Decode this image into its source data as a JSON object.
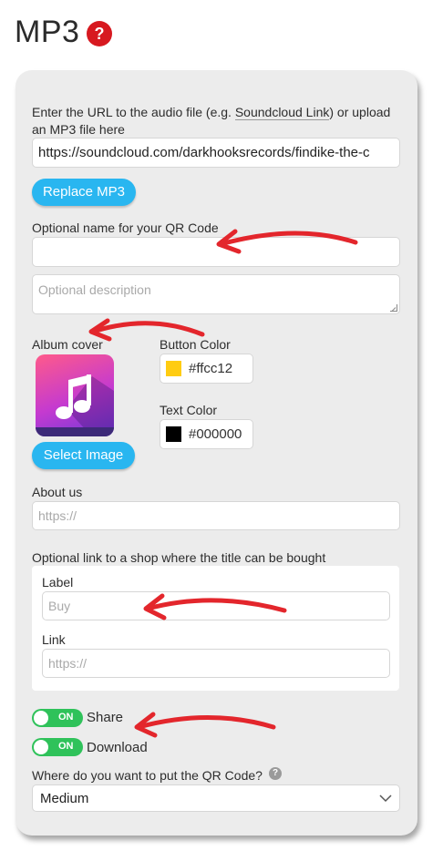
{
  "page": {
    "title": "MP3",
    "help_icon": "?"
  },
  "audio": {
    "label_part1": "Enter the URL to the audio file (e.g. ",
    "label_link": "Soundcloud Link",
    "label_part2": ") or upload an MP3 file here",
    "url_value": "https://soundcloud.com/darkhooksrecords/findike-the-c",
    "replace_button": "Replace MP3"
  },
  "name": {
    "label": "Optional name for your QR Code",
    "value": ""
  },
  "description": {
    "placeholder": "Optional description"
  },
  "album": {
    "label": "Album cover",
    "select_button": "Select Image",
    "icon": "music-note-icon"
  },
  "button_color": {
    "label": "Button Color",
    "value": "#ffcc12",
    "swatch": "#ffcc12"
  },
  "text_color": {
    "label": "Text Color",
    "value": "#000000",
    "swatch": "#000000"
  },
  "about": {
    "label": "About us",
    "placeholder": "https://"
  },
  "shop": {
    "label": "Optional link to a shop where the title can be bought",
    "label_field_label": "Label",
    "label_field_placeholder": "Buy",
    "link_field_label": "Link",
    "link_field_placeholder": "https://"
  },
  "toggles": {
    "share": {
      "state": "ON",
      "label": "Share"
    },
    "download": {
      "state": "ON",
      "label": "Download"
    }
  },
  "placement": {
    "label": "Where do you want to put the QR Code?",
    "help_icon": "?",
    "selected": "Medium"
  },
  "colors": {
    "accent_blue": "#29b6f0",
    "toggle_green": "#2fc25a",
    "help_red": "#d71920",
    "arrow_red": "#e3262c"
  }
}
